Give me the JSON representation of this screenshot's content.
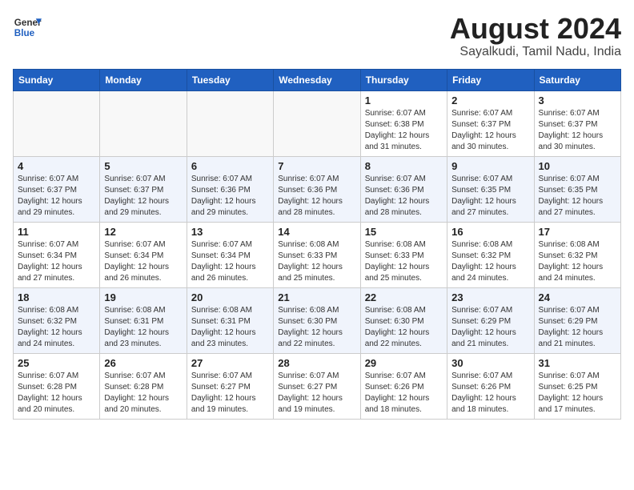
{
  "header": {
    "logo_general": "General",
    "logo_blue": "Blue",
    "month_year": "August 2024",
    "location": "Sayalkudi, Tamil Nadu, India"
  },
  "weekdays": [
    "Sunday",
    "Monday",
    "Tuesday",
    "Wednesday",
    "Thursday",
    "Friday",
    "Saturday"
  ],
  "weeks": [
    [
      {
        "day": "",
        "info": ""
      },
      {
        "day": "",
        "info": ""
      },
      {
        "day": "",
        "info": ""
      },
      {
        "day": "",
        "info": ""
      },
      {
        "day": "1",
        "info": "Sunrise: 6:07 AM\nSunset: 6:38 PM\nDaylight: 12 hours\nand 31 minutes."
      },
      {
        "day": "2",
        "info": "Sunrise: 6:07 AM\nSunset: 6:37 PM\nDaylight: 12 hours\nand 30 minutes."
      },
      {
        "day": "3",
        "info": "Sunrise: 6:07 AM\nSunset: 6:37 PM\nDaylight: 12 hours\nand 30 minutes."
      }
    ],
    [
      {
        "day": "4",
        "info": "Sunrise: 6:07 AM\nSunset: 6:37 PM\nDaylight: 12 hours\nand 29 minutes."
      },
      {
        "day": "5",
        "info": "Sunrise: 6:07 AM\nSunset: 6:37 PM\nDaylight: 12 hours\nand 29 minutes."
      },
      {
        "day": "6",
        "info": "Sunrise: 6:07 AM\nSunset: 6:36 PM\nDaylight: 12 hours\nand 29 minutes."
      },
      {
        "day": "7",
        "info": "Sunrise: 6:07 AM\nSunset: 6:36 PM\nDaylight: 12 hours\nand 28 minutes."
      },
      {
        "day": "8",
        "info": "Sunrise: 6:07 AM\nSunset: 6:36 PM\nDaylight: 12 hours\nand 28 minutes."
      },
      {
        "day": "9",
        "info": "Sunrise: 6:07 AM\nSunset: 6:35 PM\nDaylight: 12 hours\nand 27 minutes."
      },
      {
        "day": "10",
        "info": "Sunrise: 6:07 AM\nSunset: 6:35 PM\nDaylight: 12 hours\nand 27 minutes."
      }
    ],
    [
      {
        "day": "11",
        "info": "Sunrise: 6:07 AM\nSunset: 6:34 PM\nDaylight: 12 hours\nand 27 minutes."
      },
      {
        "day": "12",
        "info": "Sunrise: 6:07 AM\nSunset: 6:34 PM\nDaylight: 12 hours\nand 26 minutes."
      },
      {
        "day": "13",
        "info": "Sunrise: 6:07 AM\nSunset: 6:34 PM\nDaylight: 12 hours\nand 26 minutes."
      },
      {
        "day": "14",
        "info": "Sunrise: 6:08 AM\nSunset: 6:33 PM\nDaylight: 12 hours\nand 25 minutes."
      },
      {
        "day": "15",
        "info": "Sunrise: 6:08 AM\nSunset: 6:33 PM\nDaylight: 12 hours\nand 25 minutes."
      },
      {
        "day": "16",
        "info": "Sunrise: 6:08 AM\nSunset: 6:32 PM\nDaylight: 12 hours\nand 24 minutes."
      },
      {
        "day": "17",
        "info": "Sunrise: 6:08 AM\nSunset: 6:32 PM\nDaylight: 12 hours\nand 24 minutes."
      }
    ],
    [
      {
        "day": "18",
        "info": "Sunrise: 6:08 AM\nSunset: 6:32 PM\nDaylight: 12 hours\nand 24 minutes."
      },
      {
        "day": "19",
        "info": "Sunrise: 6:08 AM\nSunset: 6:31 PM\nDaylight: 12 hours\nand 23 minutes."
      },
      {
        "day": "20",
        "info": "Sunrise: 6:08 AM\nSunset: 6:31 PM\nDaylight: 12 hours\nand 23 minutes."
      },
      {
        "day": "21",
        "info": "Sunrise: 6:08 AM\nSunset: 6:30 PM\nDaylight: 12 hours\nand 22 minutes."
      },
      {
        "day": "22",
        "info": "Sunrise: 6:08 AM\nSunset: 6:30 PM\nDaylight: 12 hours\nand 22 minutes."
      },
      {
        "day": "23",
        "info": "Sunrise: 6:07 AM\nSunset: 6:29 PM\nDaylight: 12 hours\nand 21 minutes."
      },
      {
        "day": "24",
        "info": "Sunrise: 6:07 AM\nSunset: 6:29 PM\nDaylight: 12 hours\nand 21 minutes."
      }
    ],
    [
      {
        "day": "25",
        "info": "Sunrise: 6:07 AM\nSunset: 6:28 PM\nDaylight: 12 hours\nand 20 minutes."
      },
      {
        "day": "26",
        "info": "Sunrise: 6:07 AM\nSunset: 6:28 PM\nDaylight: 12 hours\nand 20 minutes."
      },
      {
        "day": "27",
        "info": "Sunrise: 6:07 AM\nSunset: 6:27 PM\nDaylight: 12 hours\nand 19 minutes."
      },
      {
        "day": "28",
        "info": "Sunrise: 6:07 AM\nSunset: 6:27 PM\nDaylight: 12 hours\nand 19 minutes."
      },
      {
        "day": "29",
        "info": "Sunrise: 6:07 AM\nSunset: 6:26 PM\nDaylight: 12 hours\nand 18 minutes."
      },
      {
        "day": "30",
        "info": "Sunrise: 6:07 AM\nSunset: 6:26 PM\nDaylight: 12 hours\nand 18 minutes."
      },
      {
        "day": "31",
        "info": "Sunrise: 6:07 AM\nSunset: 6:25 PM\nDaylight: 12 hours\nand 17 minutes."
      }
    ]
  ]
}
